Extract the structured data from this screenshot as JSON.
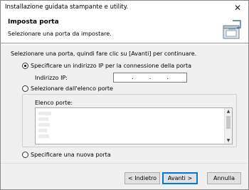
{
  "window": {
    "title": "Installazione guidata stampante e utility.",
    "close_glyph": "✕"
  },
  "header": {
    "title": "Imposta porta",
    "subtitle": "Selezionare una porta da impostare.",
    "icon": "printer-port-icon"
  },
  "main": {
    "instruction": "Selezionare una porta, quindi fare clic su [Avanti] per continuare.",
    "options": [
      {
        "label": "Specificare un indirizzo IP per la connessione della porta",
        "checked": true
      },
      {
        "label": "Selezionare dall'elenco porte",
        "checked": false
      },
      {
        "label": "Specificare una nuova porta",
        "checked": false
      }
    ],
    "ip": {
      "label": "Indirizzo IP:",
      "dots": [
        ".",
        ".",
        "."
      ]
    },
    "port_list": {
      "label": "Elenco porte:"
    }
  },
  "footer": {
    "back_label": "< Indietro",
    "next_label": "Avanti >",
    "cancel_label": "Annulla"
  }
}
